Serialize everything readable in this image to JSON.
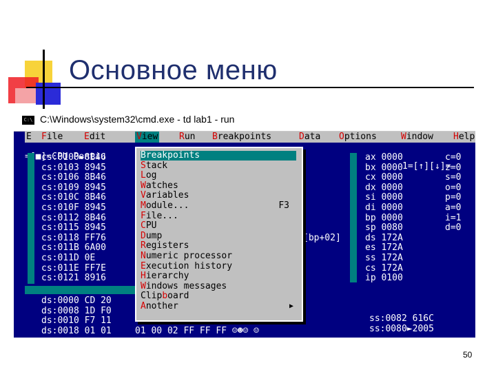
{
  "slide": {
    "title": "Основное меню",
    "number": "50"
  },
  "window": {
    "title": "C:\\Windows\\system32\\cmd.exe - td  lab1 - run",
    "icon": "C:\\"
  },
  "menubar": [
    {
      "label": "E",
      "hk": ""
    },
    {
      "label": "File",
      "hk": "F"
    },
    {
      "label": "Edit",
      "hk": "E"
    },
    {
      "label": "View",
      "hk": "V"
    },
    {
      "label": "Run",
      "hk": "R"
    },
    {
      "label": "Breakpoints",
      "hk": "B"
    },
    {
      "label": "Data",
      "hk": "D"
    },
    {
      "label": "Options",
      "hk": "O"
    },
    {
      "label": "Window",
      "hk": "W"
    },
    {
      "label": "Help",
      "hk": "H"
    }
  ],
  "cpu_pane_title": "=[■]=CPU Pentiu",
  "cpu_pane_right": "1=[↑][↓]=",
  "code_lines": [
    "cs:0100►8B46",
    "cs:0103 8945",
    "cs:0106 8B46",
    "cs:0109 8945",
    "cs:010C 8B46",
    "cs:010F 8945",
    "cs:0112 8B46",
    "cs:0115 8945",
    "cs:0118 FF76",
    "cs:011B 6A00",
    "cs:011D 0E",
    "cs:011E FF7E",
    "cs:0121 8916"
  ],
  "registers": [
    {
      "name": "ax",
      "value": "0000"
    },
    {
      "name": "bx",
      "value": "0000"
    },
    {
      "name": "cx",
      "value": "0000"
    },
    {
      "name": "dx",
      "value": "0000"
    },
    {
      "name": "si",
      "value": "0000"
    },
    {
      "name": "di",
      "value": "0000"
    },
    {
      "name": "bp",
      "value": "0000"
    },
    {
      "name": "sp",
      "value": "0080"
    },
    {
      "name": "ds",
      "value": "172A"
    },
    {
      "name": "es",
      "value": "172A"
    },
    {
      "name": "ss",
      "value": "172A"
    },
    {
      "name": "cs",
      "value": "172A"
    },
    {
      "name": "ip",
      "value": "0100"
    }
  ],
  "flags": [
    "c=0",
    "z=0",
    "s=0",
    "o=0",
    "p=0",
    "a=0",
    "i=1",
    "d=0"
  ],
  "dump_lines": [
    "ds:0000 CD 20",
    "ds:0008 1D F0",
    "ds:0010 F7 11",
    "ds:0018 01 01"
  ],
  "dump_tail": "01 00 02 FF FF FF ☺☻☺ ☺",
  "bp_hint": "[bp+02]",
  "stack_lines": [
    "ss:0082 616C",
    "ss:0080►2005"
  ],
  "view_menu": [
    {
      "label": "Breakpoints",
      "hk": "B",
      "shortcut": "",
      "submenu": false,
      "selected": true
    },
    {
      "label": "Stack",
      "hk": "S",
      "shortcut": "",
      "submenu": false,
      "selected": false
    },
    {
      "label": "Log",
      "hk": "L",
      "shortcut": "",
      "submenu": false,
      "selected": false
    },
    {
      "label": "Watches",
      "hk": "W",
      "shortcut": "",
      "submenu": false,
      "selected": false
    },
    {
      "label": "Variables",
      "hk": "V",
      "shortcut": "",
      "submenu": false,
      "selected": false
    },
    {
      "label": "Module...",
      "hk": "M",
      "shortcut": "F3",
      "submenu": false,
      "selected": false
    },
    {
      "label": "File...",
      "hk": "F",
      "shortcut": "",
      "submenu": false,
      "selected": false
    },
    {
      "label": "CPU",
      "hk": "C",
      "shortcut": "",
      "submenu": false,
      "selected": false
    },
    {
      "label": "Dump",
      "hk": "D",
      "shortcut": "",
      "submenu": false,
      "selected": false
    },
    {
      "label": "Registers",
      "hk": "R",
      "shortcut": "",
      "submenu": false,
      "selected": false
    },
    {
      "label": "Numeric processor",
      "hk": "N",
      "shortcut": "",
      "submenu": false,
      "selected": false
    },
    {
      "label": "Execution history",
      "hk": "E",
      "shortcut": "",
      "submenu": false,
      "selected": false
    },
    {
      "label": "Hierarchy",
      "hk": "H",
      "shortcut": "",
      "submenu": false,
      "selected": false
    },
    {
      "label": "Windows messages",
      "hk": "W",
      "shortcut": "",
      "submenu": false,
      "selected": false
    },
    {
      "label": "Clipboard",
      "hk": "b",
      "shortcut": "",
      "submenu": false,
      "selected": false
    },
    {
      "label": "Another",
      "hk": "A",
      "shortcut": "",
      "submenu": true,
      "selected": false
    }
  ],
  "colors": {
    "console_bg": "#000080",
    "menu_gray": "#c0c0c0",
    "highlight": "#008080",
    "hotkey": "#d40000",
    "title_color": "#1f2f6e"
  }
}
